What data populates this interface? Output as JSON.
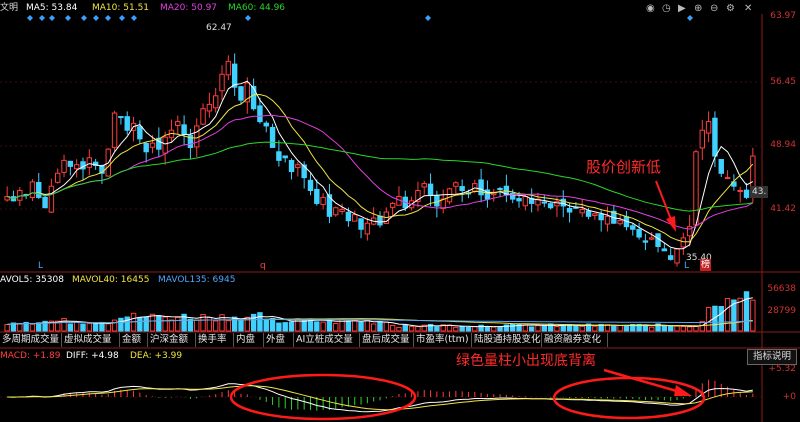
{
  "stock": {
    "name_fragment": "文明"
  },
  "ma_legend": [
    {
      "label": "MA5: 53.84",
      "color": "#ffffff"
    },
    {
      "label": "MA10: 51.51",
      "color": "#f0e442"
    },
    {
      "label": "MA20: 50.97",
      "color": "#e040e0"
    },
    {
      "label": "MA60: 44.96",
      "color": "#2ad52a"
    }
  ],
  "price_axis": [
    "63.97",
    "56.45",
    "48.94",
    "41.42"
  ],
  "last_price_label": "43.",
  "price_annotations": {
    "high": "62.47",
    "low": "35.40",
    "marker_L1": "L",
    "marker_q": "q",
    "marker_L2": "L",
    "marker_bang": "榜"
  },
  "volume_legend": [
    {
      "label": "AVOL5: 35308",
      "color": "#ffffff"
    },
    {
      "label": "MAVOL40: 16455",
      "color": "#f0e442"
    },
    {
      "label": "MAVOL135: 6945",
      "color": "#4da6ff"
    }
  ],
  "volume_axis": [
    "56638",
    "28799"
  ],
  "tabs": [
    "多周期成交量",
    "虚拟成交量",
    "金额",
    "沪深金额",
    "换手率",
    "内盘",
    "外盘",
    "AI立桩成交量",
    "盘后成交量",
    "市盈率(ttm)",
    "陆股通持股变化",
    "融资融券变化"
  ],
  "macd_legend": [
    {
      "label": "MACD: +1.89",
      "color": "#ff4040"
    },
    {
      "label": "DIFF: +4.98",
      "color": "#ffffff"
    },
    {
      "label": "DEA: +3.99",
      "color": "#f0e442"
    }
  ],
  "macd_axis": [
    "+5.32",
    "+0"
  ],
  "indicator_button": "指标说明",
  "annotation_price": "股价创新低",
  "annotation_volume": "绿色量柱小出现底背离",
  "toolbar_icons": [
    "eye-icon",
    "history-icon",
    "play-icon",
    "zoom-in-icon",
    "zoom-out-icon",
    "settings-icon",
    "close-icon"
  ],
  "chart_data": {
    "type": "candlestick",
    "panels": [
      "price",
      "volume",
      "macd"
    ],
    "price_ylim": [
      35.0,
      64.5
    ],
    "price_ticks": [
      63.97,
      56.45,
      48.94,
      41.42
    ],
    "close": [
      43.3,
      42.8,
      44.0,
      43.5,
      45.0,
      43.2,
      42.0,
      44.5,
      46.0,
      47.5,
      46.8,
      47.0,
      46.5,
      47.8,
      46.9,
      46.0,
      48.8,
      53.0,
      52.5,
      51.0,
      51.8,
      50.0,
      48.5,
      49.5,
      48.8,
      50.2,
      51.0,
      52.0,
      50.5,
      49.0,
      51.5,
      53.5,
      54.0,
      55.0,
      57.5,
      59.0,
      56.0,
      54.5,
      56.5,
      53.5,
      52.0,
      51.5,
      49.0,
      47.5,
      47.8,
      46.2,
      47.0,
      45.5,
      44.0,
      42.5,
      43.2,
      41.0,
      42.0,
      41.8,
      40.5,
      41.2,
      39.5,
      40.2,
      40.8,
      40.0,
      41.5,
      42.5,
      43.3,
      42.0,
      42.8,
      44.0,
      44.8,
      43.5,
      42.2,
      43.0,
      44.2,
      44.9,
      44.0,
      43.6,
      44.8,
      43.5,
      43.0,
      43.8,
      44.2,
      43.5,
      43.0,
      42.8,
      43.3,
      42.5,
      43.0,
      42.6,
      42.0,
      42.7,
      42.2,
      41.5,
      42.0,
      41.8,
      41.0,
      41.3,
      40.6,
      41.0,
      40.2,
      40.5,
      39.8,
      39.5,
      38.6,
      38.0,
      38.5,
      37.5,
      37.0,
      36.0,
      37.2,
      38.5,
      39.8,
      48.5,
      51.0,
      52.0,
      48.0,
      46.0,
      45.5,
      44.5,
      44.0,
      43.2,
      48.0
    ],
    "ma_values_last": {
      "MA5": 53.84,
      "MA10": 51.51,
      "MA20": 50.97,
      "MA60": 44.96
    },
    "volume_values_last": {
      "VOL5": 35308,
      "MAVOL40": 16455,
      "MAVOL135": 6945
    },
    "volume_ylim": [
      0,
      60000
    ],
    "volume_ticks": [
      56638,
      28799
    ],
    "macd_last": {
      "MACD": 1.89,
      "DIFF": 4.98,
      "DEA": 3.99
    },
    "macd_ticks": [
      5.32,
      0
    ]
  }
}
